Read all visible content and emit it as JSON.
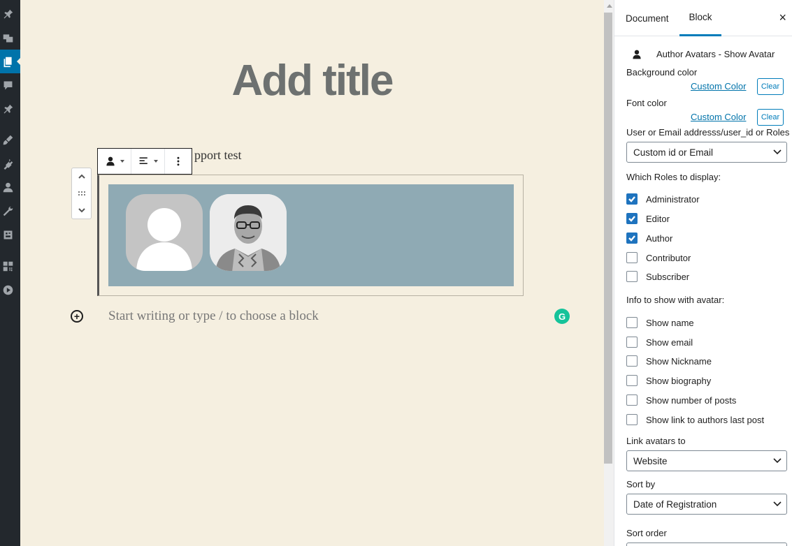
{
  "editor": {
    "title_placeholder": "Add title",
    "behind_text": "pport test",
    "block_placeholder": "Start writing or type / to choose a block",
    "inserter_symbol": "+",
    "grammarly_letter": "G"
  },
  "panel": {
    "tabs": {
      "document": "Document",
      "block": "Block"
    },
    "close_symbol": "×",
    "block_name": "Author Avatars - Show Avatar",
    "background_color_label": "Background color",
    "font_color_label": "Font color",
    "custom_color_link": "Custom Color",
    "clear_label": "Clear",
    "user_or_email_label": "User or Email addresss/user_id or Roles",
    "user_or_email_value": "Custom id or Email",
    "roles_label": "Which Roles to display:",
    "roles": [
      {
        "label": "Administrator",
        "checked": true
      },
      {
        "label": "Editor",
        "checked": true
      },
      {
        "label": "Author",
        "checked": true
      },
      {
        "label": "Contributor",
        "checked": false
      },
      {
        "label": "Subscriber",
        "checked": false
      }
    ],
    "info_label": "Info to show with avatar:",
    "info": [
      {
        "label": "Show name",
        "checked": false
      },
      {
        "label": "Show email",
        "checked": false
      },
      {
        "label": "Show Nickname",
        "checked": false
      },
      {
        "label": "Show biography",
        "checked": false
      },
      {
        "label": "Show number of posts",
        "checked": false
      },
      {
        "label": "Show link to authors last post",
        "checked": false
      }
    ],
    "link_label": "Link avatars to",
    "link_value": "Website",
    "sort_by_label": "Sort by",
    "sort_by_value": "Date of Registration",
    "sort_order_label": "Sort order"
  },
  "colors": {
    "accent": "#007cba",
    "checkbox_checked": "#1e73be",
    "avatar_background": "#8faab4",
    "canvas_background": "#f5efe0",
    "admin_sidebar": "#23282d"
  },
  "icons": {
    "admin_menu": [
      "pin-icon",
      "media-icon",
      "pages-icon",
      "comments-icon",
      "pin-icon",
      "appearance-icon",
      "plugins-icon",
      "users-icon",
      "tools-icon",
      "settings-icon",
      "blocks-icon",
      "media-play-icon"
    ],
    "block_icon": "person-icon"
  }
}
